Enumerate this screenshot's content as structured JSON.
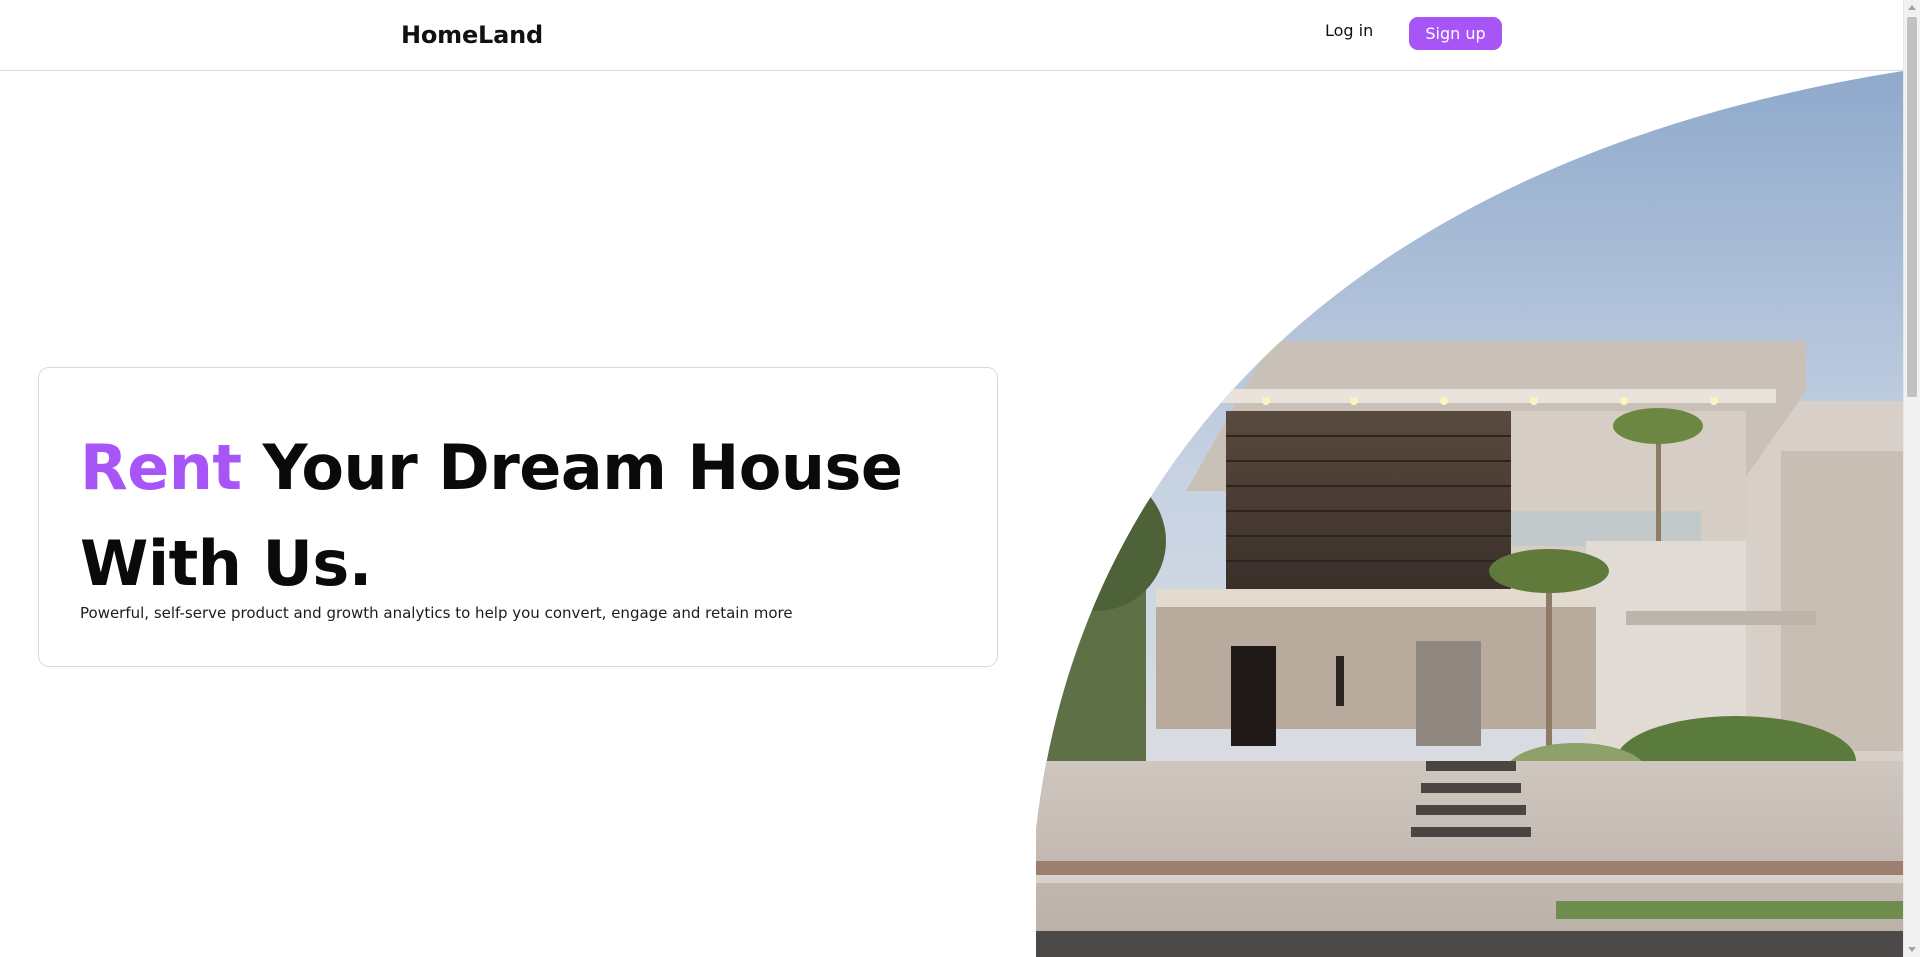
{
  "header": {
    "logo": "HomeLand",
    "login_label": "Log in",
    "signup_label": "Sign up"
  },
  "hero": {
    "title_accent": "Rent",
    "title_rest": "Your Dream House With Us.",
    "subtitle": "Powerful, self-serve product and growth analytics to help you convert, engage and retain more",
    "image_icon": "modern-house-photo"
  },
  "colors": {
    "accent": "#a855f7",
    "text": "#0a0a0a",
    "border": "#d9d9d9"
  }
}
